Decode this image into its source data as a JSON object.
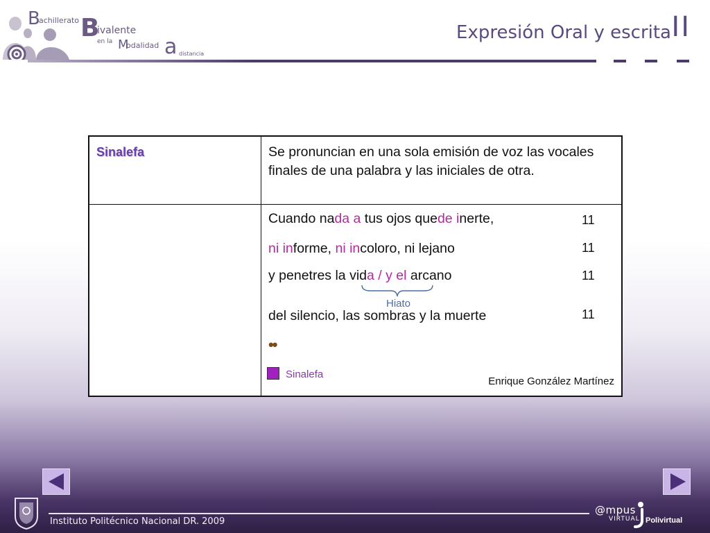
{
  "header": {
    "logo": {
      "b1": "B",
      "b1_rest": "achillerato",
      "b2": "B",
      "b2_rest": "ivalente",
      "en_la": "en la",
      "m": "M",
      "m_rest": "odalidad",
      "a": "a",
      "a_rest": "distancia"
    },
    "course_title": "Expresión Oral  y escrita",
    "course_roman": "II"
  },
  "table": {
    "term": "Sinalefa",
    "definition": "Se pronuncian en una sola emisión de voz las vocales finales de una palabra y las iniciales de otra.",
    "verses": [
      {
        "parts": [
          {
            "t": "Cuando na",
            "h": false
          },
          {
            "t": "da a",
            "h": true
          },
          {
            "t": " tus ojos que",
            "h": false
          },
          {
            "t": "de i",
            "h": true
          },
          {
            "t": "nerte,",
            "h": false
          }
        ],
        "syllables": "11"
      },
      {
        "parts": [
          {
            "t": "ni in",
            "h": true
          },
          {
            "t": "forme, ",
            "h": false
          },
          {
            "t": "ni in",
            "h": true
          },
          {
            "t": "coloro, ni lejano",
            "h": false
          }
        ],
        "syllables": "11"
      },
      {
        "parts": [
          {
            "t": "y penetres la vid",
            "h": false
          },
          {
            "t": "a / y el",
            "h": true
          },
          {
            "t": " arcano",
            "h": false
          }
        ],
        "syllables": "11"
      },
      {
        "parts": [
          {
            "t": "del silencio, las sombras y la muerte",
            "h": false
          }
        ],
        "syllables": "11"
      }
    ],
    "hiato_label": "Hiato",
    "dots": "••",
    "legend_label": "Sinalefa",
    "author": "Enrique González Martínez"
  },
  "colors": {
    "highlight": "#b32aa0",
    "legend": "#a020c0",
    "accent": "#4b3a6a",
    "term": "#6a3fa8"
  },
  "nav": {
    "prev_icon": "triangle-left-icon",
    "next_icon": "triangle-right-icon"
  },
  "footer": {
    "institute": "Instituto Politécnico Nacional DR. 2009",
    "campus_1": "@mpus",
    "campus_2": "VIRTUAL",
    "polivirtual": "Polivirtual"
  }
}
